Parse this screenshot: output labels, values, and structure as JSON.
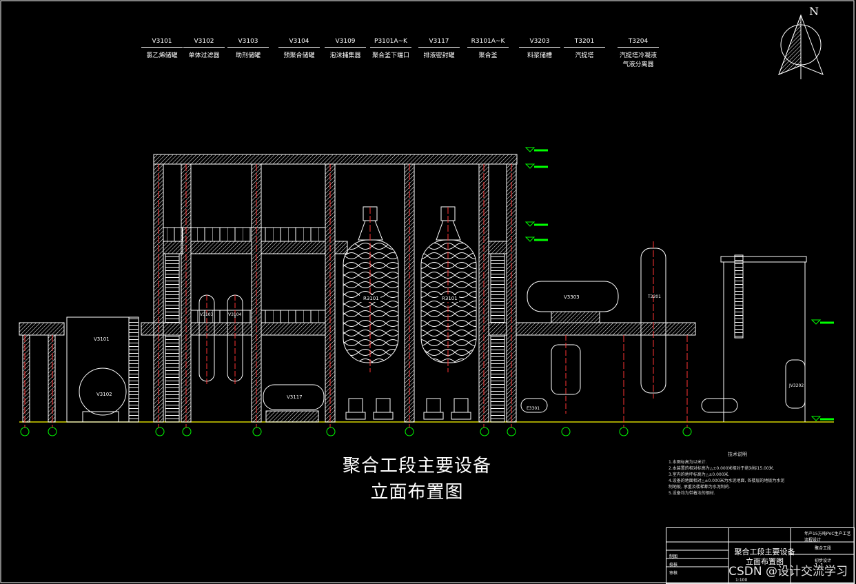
{
  "legend": [
    {
      "tag": "V3101",
      "name": "氯乙烯储罐"
    },
    {
      "tag": "V3102",
      "name": "单体过滤器"
    },
    {
      "tag": "V3103",
      "name": "助剂储罐"
    },
    {
      "tag": "V3104",
      "name": "预聚合储罐"
    },
    {
      "tag": "V3109",
      "name": "泡沫捕集器"
    },
    {
      "tag": "P3101A~K",
      "name": "聚合釜下端口"
    },
    {
      "tag": "V3117",
      "name": "排液密封罐"
    },
    {
      "tag": "R3101A~K",
      "name": "聚合釜"
    },
    {
      "tag": "V3203",
      "name": "料浆储槽"
    },
    {
      "tag": "T3201",
      "name": "汽提塔"
    },
    {
      "tag": "T3204",
      "name": "汽提塔冷凝液气液分离器"
    }
  ],
  "north": "N",
  "equipment_labels": {
    "v3101": "V3101",
    "v3102": "V3102",
    "v3103": "V3103",
    "v3104": "V3104",
    "v3117": "V3117",
    "r1": "R3101",
    "r2": "R3101",
    "v3303": "V3303",
    "t3201": "T3201",
    "e3301": "E3301",
    "jv3202": "JV3202"
  },
  "title_line1": "聚合工段主要设备",
  "title_line2": "立面布置图",
  "notes": {
    "heading": "技术说明",
    "lines": [
      "1.本图标高为以米计.",
      "2.本装置的相对标高为△±0.000米相对于绝对标15.00米.",
      "3.室内的地坪标高为△±0.000米.",
      "4.设备的地面相对△±0.000米为水泥地面, 各楼层的地板为水泥",
      "  制地板, 承重及楼梯都为水泥制的.",
      "5.设备均为带着法的钢材."
    ]
  },
  "title_block": {
    "drawing_name": "聚合工段主要设备立面布置图",
    "project": "年产15万吨PVC生产工艺流程设计",
    "section": "聚合工段",
    "design": "初步设计",
    "scale": "1:100",
    "sheet": "1-1",
    "rows": [
      "制图",
      "校核",
      "审核"
    ]
  },
  "watermark": "CSDN @设计交流学习"
}
